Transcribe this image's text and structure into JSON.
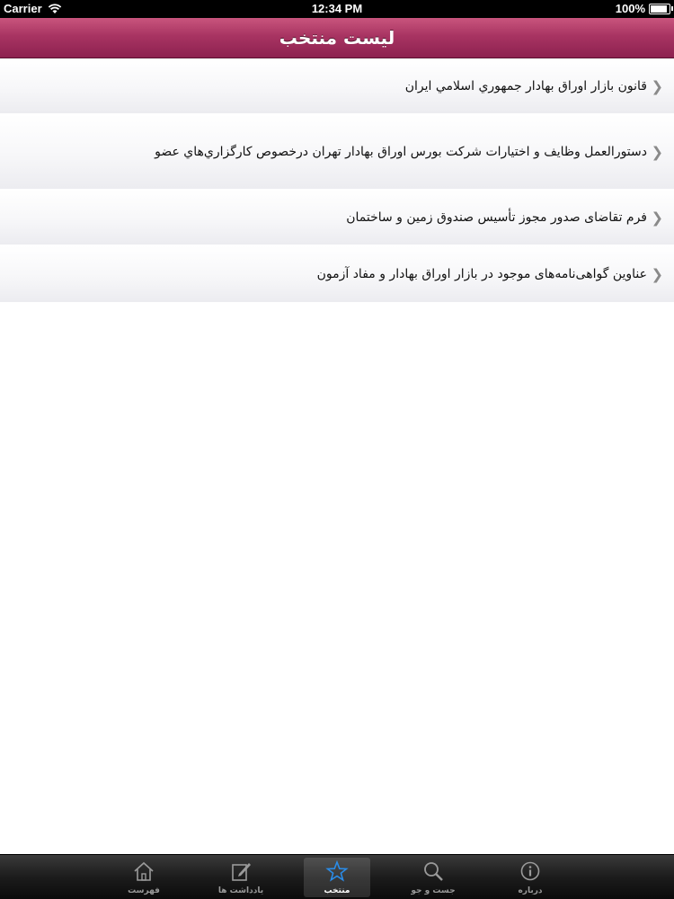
{
  "status_bar": {
    "carrier": "Carrier",
    "time": "12:34 PM",
    "battery": "100%",
    "battery_level": 1.0
  },
  "nav": {
    "title": "لیست منتخب"
  },
  "list": {
    "items": [
      {
        "label": "قانون بازار اوراق بهادار جمهوري اسلامي ايران"
      },
      {
        "label": "دستورالعمل وظایف و اختیارات شرکت بورس اوراق بهادار تهران درخصوص کارگزاري‌هاي عضو"
      },
      {
        "label": "فرم تقاضای صدور مجوز تأسیس صندوق زمین و ساختمان"
      },
      {
        "label": "عناوین گواهی‌نامه‌های موجود در بازار اوراق بهادار و مفاد آزمون"
      }
    ]
  },
  "tabbar": {
    "tabs": [
      {
        "label": "فهرست",
        "icon": "home-icon"
      },
      {
        "label": "يادداشت ها",
        "icon": "note-edit-icon"
      },
      {
        "label": "منتخب",
        "icon": "star-icon",
        "active": true
      },
      {
        "label": "جست و جو",
        "icon": "search-icon"
      },
      {
        "label": "درباره",
        "icon": "info-icon"
      }
    ]
  },
  "colors": {
    "nav_accent": "#a83462",
    "star_active": "#2a8ce8"
  }
}
